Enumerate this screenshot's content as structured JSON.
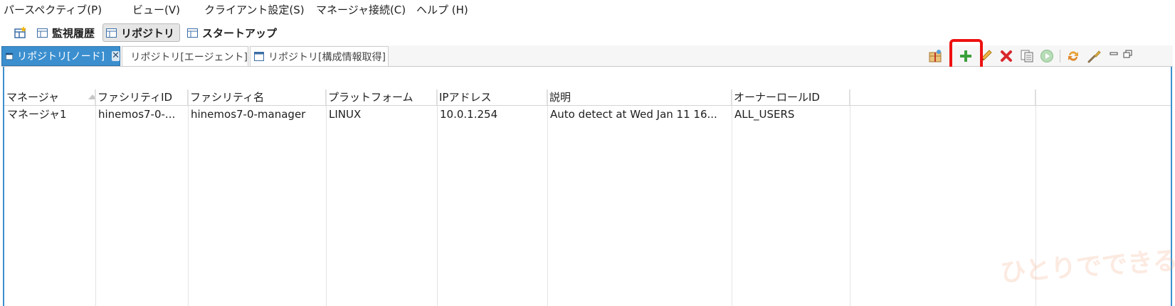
{
  "menu": [
    "パースペクティブ(P)",
    "ビュー(V)",
    "クライアント設定(S)",
    "マネージャ接続(C)",
    "ヘルプ (H)"
  ],
  "perspectives": [
    "監視履歴",
    "リポジトリ",
    "スタートアップ"
  ],
  "active_perspective": "リポジトリ",
  "tabs": [
    "リポジトリ[ノード]",
    "リポジトリ[エージェント]",
    "リポジトリ[構成情報取得]"
  ],
  "active_tab": "リポジトリ[ノード]",
  "toolbar_icons": [
    "filter-icon",
    "add-icon",
    "edit-icon",
    "delete-icon",
    "copy-icon",
    "run-icon",
    "refresh-icon",
    "settings-icon",
    "minimize-icon",
    "maximize-icon"
  ],
  "highlighted_toolbar_icon": "add-icon",
  "colors": {
    "accent": "#3b8fcf",
    "highlight": "#ee1111",
    "add": "#3aa03a",
    "delete": "#d9282d"
  },
  "table": {
    "columns": [
      "マネージャ",
      "ファシリティID",
      "ファシリティ名",
      "プラットフォーム",
      "IPアドレス",
      "説明",
      "オーナーロールID"
    ],
    "rows": [
      [
        "マネージャ1",
        "hinemos7-0-...",
        "hinemos7-0-manager",
        "LINUX",
        "10.0.1.254",
        "Auto detect at Wed Jan 11 16...",
        "ALL_USERS"
      ]
    ]
  },
  "watermark": "ひとりでできるもん"
}
